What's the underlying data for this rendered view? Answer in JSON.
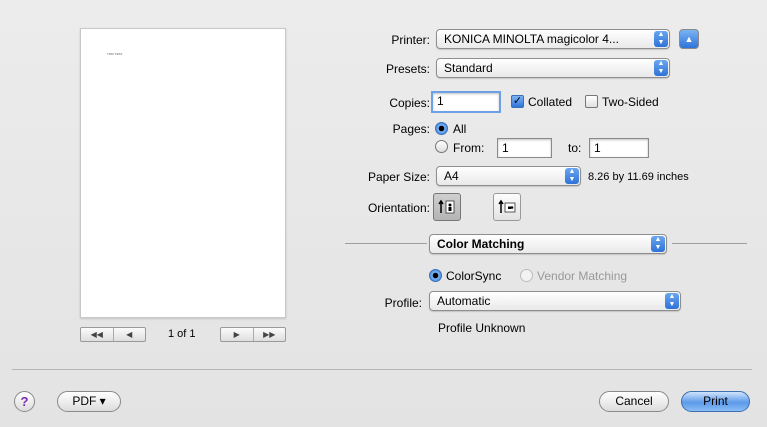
{
  "preview": {
    "page_text": "TWO TEST",
    "page_counter": "1 of 1"
  },
  "printer": {
    "label": "Printer:",
    "value": "KONICA MINOLTA magicolor 4..."
  },
  "presets": {
    "label": "Presets:",
    "value": "Standard"
  },
  "copies": {
    "label": "Copies:",
    "value": "1",
    "collated_label": "Collated",
    "collated": true,
    "two_sided_label": "Two-Sided",
    "two_sided": false
  },
  "pages": {
    "label": "Pages:",
    "all_label": "All",
    "from_label": "From:",
    "from_value": "1",
    "to_label": "to:",
    "to_value": "1",
    "selected": "All"
  },
  "paper_size": {
    "label": "Paper Size:",
    "value": "A4",
    "dimensions": "8.26 by 11.69 inches"
  },
  "orientation": {
    "label": "Orientation:",
    "selected": "portrait"
  },
  "section": {
    "value": "Color Matching"
  },
  "color_matching": {
    "colorsync_label": "ColorSync",
    "vendor_label": "Vendor Matching",
    "selected": "ColorSync"
  },
  "profile": {
    "label": "Profile:",
    "value": "Automatic",
    "status": "Profile Unknown"
  },
  "footer": {
    "help_glyph": "?",
    "pdf_label": "PDF ▾",
    "cancel_label": "Cancel",
    "print_label": "Print"
  },
  "colors": {
    "accent": "#2f74d9",
    "default_button": "#5d9ae9"
  },
  "icons": {
    "first": "first-page-icon",
    "prev": "prev-page-icon",
    "next": "next-page-icon",
    "last": "last-page-icon"
  }
}
